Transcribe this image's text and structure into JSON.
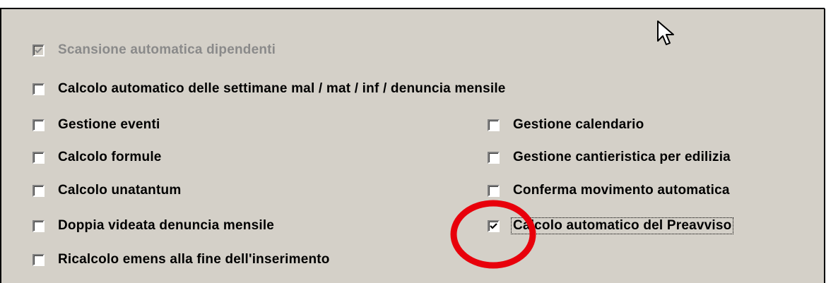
{
  "options": {
    "scansione": {
      "label": "Scansione automatica dipendenti",
      "checked": true,
      "enabled": false
    },
    "calcolo_settimane": {
      "label": "Calcolo automatico delle settimane mal / mat / inf / denuncia mensile",
      "checked": false
    },
    "gestione_eventi": {
      "label": "Gestione eventi",
      "checked": false
    },
    "calcolo_formule": {
      "label": "Calcolo formule",
      "checked": false
    },
    "calcolo_unatantum": {
      "label": "Calcolo unatantum",
      "checked": false
    },
    "doppia_videata": {
      "label": "Doppia videata denuncia mensile",
      "checked": false
    },
    "ricalcolo_emens": {
      "label": "Ricalcolo emens alla fine dell'inserimento",
      "checked": false
    },
    "gestione_calendario": {
      "label": "Gestione calendario",
      "checked": false
    },
    "gestione_cantieristica": {
      "label": "Gestione cantieristica per edilizia",
      "checked": false
    },
    "conferma_movimento": {
      "label": "Conferma movimento automatica",
      "checked": false
    },
    "calcolo_preavviso": {
      "label": "Calcolo automatico del Preavviso",
      "checked": true
    }
  },
  "annotation": {
    "color": "#e8000b"
  },
  "colors": {
    "panel": "#d4d0c8",
    "disabled_text": "#8a8a8a"
  }
}
